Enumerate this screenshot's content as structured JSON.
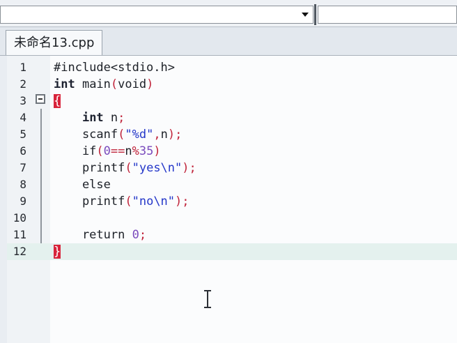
{
  "file_tab": {
    "label": "未命名13.cpp"
  },
  "colors": {
    "keyword": "#1d2230",
    "string": "#2437c9",
    "number": "#7a4bbd",
    "punctuation": "#c0233a",
    "brace_highlight": "#d8243b",
    "active_line": "#e4f1ee"
  },
  "editor": {
    "lines": [
      {
        "num": "1",
        "tokens": [
          {
            "t": "#include<stdio.h>",
            "c": "plain"
          }
        ]
      },
      {
        "num": "2",
        "tokens": [
          {
            "t": "int",
            "c": "kw"
          },
          {
            "t": " main",
            "c": "plain"
          },
          {
            "t": "(",
            "c": "punc"
          },
          {
            "t": "void",
            "c": "plain"
          },
          {
            "t": ")",
            "c": "punc"
          }
        ]
      },
      {
        "num": "3",
        "tokens": [
          {
            "t": "{",
            "c": "brace"
          }
        ]
      },
      {
        "num": "4",
        "tokens": [
          {
            "t": "    ",
            "c": "plain"
          },
          {
            "t": "int",
            "c": "kw"
          },
          {
            "t": " n",
            "c": "plain"
          },
          {
            "t": ";",
            "c": "punc"
          }
        ]
      },
      {
        "num": "5",
        "tokens": [
          {
            "t": "    scanf",
            "c": "plain"
          },
          {
            "t": "(",
            "c": "punc"
          },
          {
            "t": "\"%d\"",
            "c": "str"
          },
          {
            "t": ",",
            "c": "punc"
          },
          {
            "t": "n",
            "c": "plain"
          },
          {
            "t": ");",
            "c": "punc"
          }
        ]
      },
      {
        "num": "6",
        "tokens": [
          {
            "t": "    if",
            "c": "plain"
          },
          {
            "t": "(",
            "c": "punc"
          },
          {
            "t": "0",
            "c": "num"
          },
          {
            "t": "==",
            "c": "punc"
          },
          {
            "t": "n",
            "c": "plain"
          },
          {
            "t": "%",
            "c": "punc"
          },
          {
            "t": "35",
            "c": "num"
          },
          {
            "t": ")",
            "c": "punc"
          }
        ]
      },
      {
        "num": "7",
        "tokens": [
          {
            "t": "    printf",
            "c": "plain"
          },
          {
            "t": "(",
            "c": "punc"
          },
          {
            "t": "\"yes\\n\"",
            "c": "str"
          },
          {
            "t": ");",
            "c": "punc"
          }
        ]
      },
      {
        "num": "8",
        "tokens": [
          {
            "t": "    else",
            "c": "plain"
          }
        ]
      },
      {
        "num": "9",
        "tokens": [
          {
            "t": "    printf",
            "c": "plain"
          },
          {
            "t": "(",
            "c": "punc"
          },
          {
            "t": "\"no\\n\"",
            "c": "str"
          },
          {
            "t": ");",
            "c": "punc"
          }
        ]
      },
      {
        "num": "10",
        "tokens": []
      },
      {
        "num": "11",
        "tokens": [
          {
            "t": "    return ",
            "c": "plain"
          },
          {
            "t": "0",
            "c": "num"
          },
          {
            "t": ";",
            "c": "punc"
          }
        ]
      },
      {
        "num": "12",
        "tokens": [
          {
            "t": "}",
            "c": "brace"
          }
        ],
        "active": true
      }
    ]
  }
}
